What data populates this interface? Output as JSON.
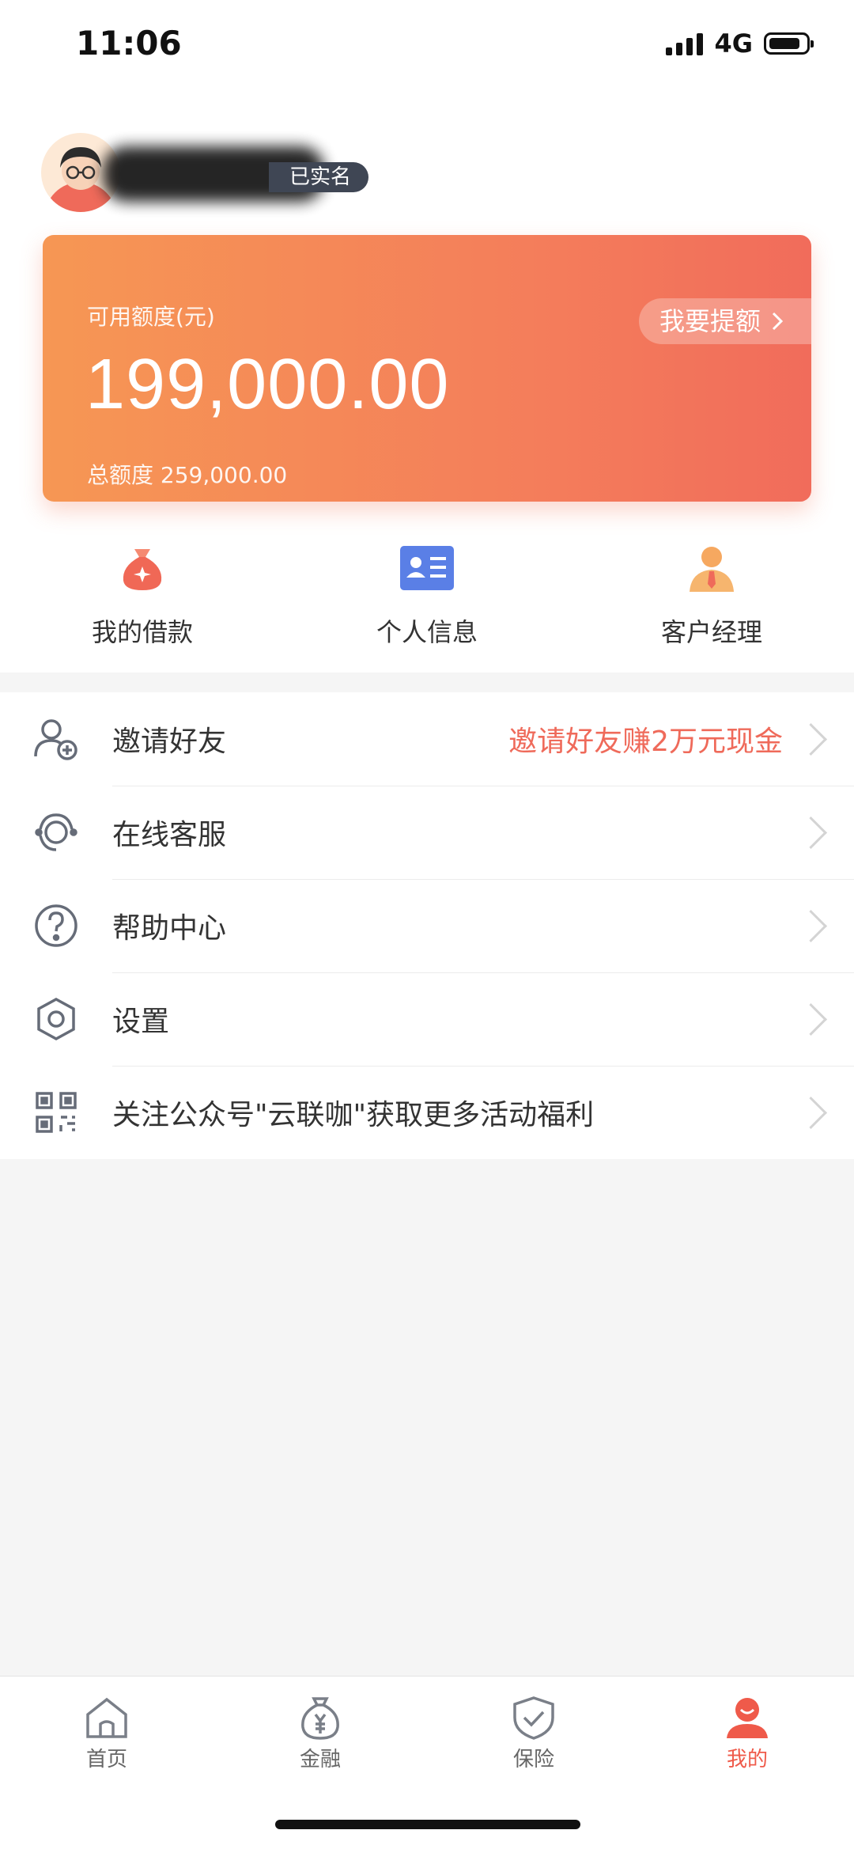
{
  "status_bar": {
    "time": "11:06",
    "network": "4G"
  },
  "profile": {
    "verify_badge": "已实名"
  },
  "credit_card": {
    "available_label": "可用额度(元)",
    "available_amount": "199,000.00",
    "total_label": "总额度 259,000.00",
    "raise_button": "我要提额"
  },
  "quick_entries": [
    {
      "label": "我的借款",
      "icon": "money-bag-icon"
    },
    {
      "label": "个人信息",
      "icon": "id-card-icon"
    },
    {
      "label": "客户经理",
      "icon": "manager-icon"
    }
  ],
  "menu": [
    {
      "label": "邀请好友",
      "extra": "邀请好友赚2万元现金",
      "icon": "invite-friend-icon"
    },
    {
      "label": "在线客服",
      "extra": "",
      "icon": "customer-service-icon"
    },
    {
      "label": "帮助中心",
      "extra": "",
      "icon": "help-icon"
    },
    {
      "label": "设置",
      "extra": "",
      "icon": "settings-icon"
    },
    {
      "label": "关注公众号\"云联咖\"获取更多活动福利",
      "extra": "",
      "icon": "qr-code-icon"
    }
  ],
  "tabbar": [
    {
      "label": "首页",
      "icon": "home-icon"
    },
    {
      "label": "金融",
      "icon": "finance-icon"
    },
    {
      "label": "保险",
      "icon": "insurance-shield-icon"
    },
    {
      "label": "我的",
      "icon": "profile-icon",
      "active": true
    }
  ],
  "colors": {
    "accent": "#ef5a4a",
    "card_start": "#f69754",
    "card_end": "#f16c5b"
  }
}
